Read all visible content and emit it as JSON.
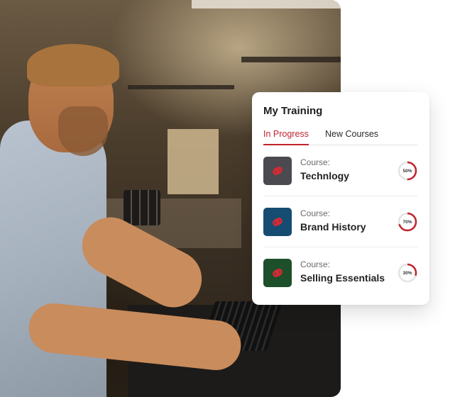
{
  "training": {
    "title": "My Training",
    "tabs": [
      {
        "label": "In Progress",
        "active": true
      },
      {
        "label": "New Courses",
        "active": false
      }
    ],
    "courses": [
      {
        "kicker": "Course:",
        "name": "Technlogy",
        "progress": "50%",
        "progress_value": 50,
        "thumb_color": "#4a4a50",
        "icon": "chain-link-icon"
      },
      {
        "kicker": "Course:",
        "name": "Brand History",
        "progress": "70%",
        "progress_value": 70,
        "thumb_color": "#154c72",
        "icon": "chain-link-icon"
      },
      {
        "kicker": "Course:",
        "name": "Selling Essentials",
        "progress": "30%",
        "progress_value": 30,
        "thumb_color": "#1d4f2a",
        "icon": "chain-link-icon"
      }
    ]
  },
  "colors": {
    "accent": "#c0242c",
    "ring_track": "#e3e3e3"
  }
}
